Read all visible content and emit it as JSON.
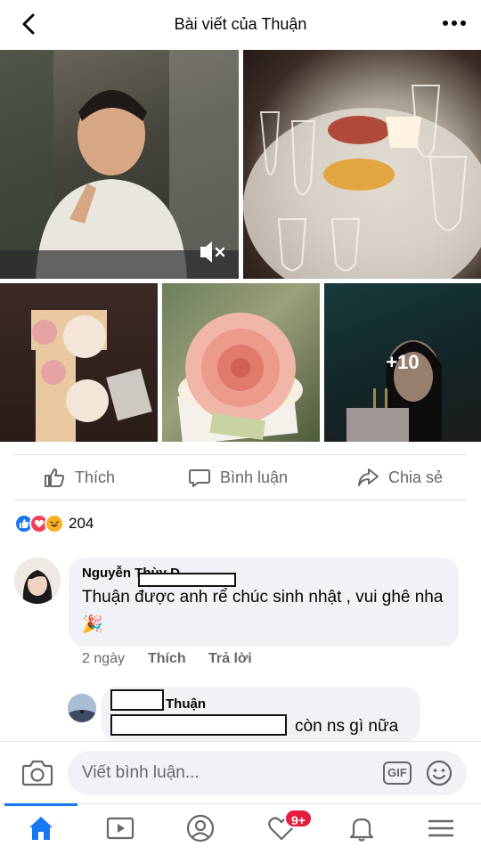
{
  "header": {
    "title": "Bài viết của Thuận"
  },
  "photos": {
    "more_count": "+10"
  },
  "actions": {
    "like": "Thích",
    "comment": "Bình luận",
    "share": "Chia sẻ"
  },
  "reactions": {
    "count": "204",
    "types": [
      "like-icon",
      "love-icon",
      "haha-icon"
    ]
  },
  "comments": [
    {
      "author": "Nguyễn Thùy D",
      "text": "Thuận được anh rể chúc sinh nhật , vui ghê nha 🎉",
      "time": "2 ngày",
      "like_label": "Thích",
      "reply_label": "Trả lời"
    },
    {
      "author": "Thuận",
      "text": "còn ns gì nữa"
    }
  ],
  "composer": {
    "placeholder": "Viết bình luận...",
    "gif_label": "GIF"
  },
  "tabbar": {
    "notification_badge": "9+"
  },
  "colors": {
    "accent": "#1877f2",
    "badge": "#e41e3f",
    "bubble": "#f0f2f5"
  }
}
